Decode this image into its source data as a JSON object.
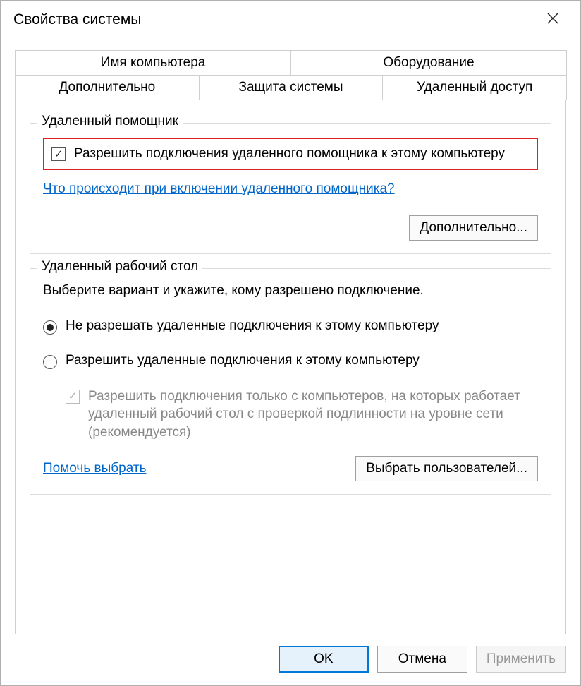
{
  "window": {
    "title": "Свойства системы"
  },
  "tabs": {
    "row1": [
      {
        "label": "Имя компьютера"
      },
      {
        "label": "Оборудование"
      }
    ],
    "row2": [
      {
        "label": "Дополнительно"
      },
      {
        "label": "Защита системы"
      },
      {
        "label": "Удаленный доступ",
        "active": true
      }
    ]
  },
  "remote_assistance": {
    "group_title": "Удаленный помощник",
    "allow_label": "Разрешить подключения удаленного помощника к этому компьютеру",
    "help_link": "Что происходит при включении удаленного помощника?",
    "advanced_btn": "Дополнительно..."
  },
  "remote_desktop": {
    "group_title": "Удаленный рабочий стол",
    "description": "Выберите вариант и укажите, кому разрешено подключение.",
    "radio_deny": "Не разрешать удаленные подключения к этому компьютеру",
    "radio_allow": "Разрешить удаленные подключения к этому компьютеру",
    "nla_checkbox": "Разрешить подключения только с компьютеров, на которых работает удаленный рабочий стол с проверкой подлинности на уровне сети (рекомендуется)",
    "help_choose_link": "Помочь выбрать",
    "select_users_btn": "Выбрать пользователей..."
  },
  "dialog_buttons": {
    "ok": "OK",
    "cancel": "Отмена",
    "apply": "Применить"
  }
}
